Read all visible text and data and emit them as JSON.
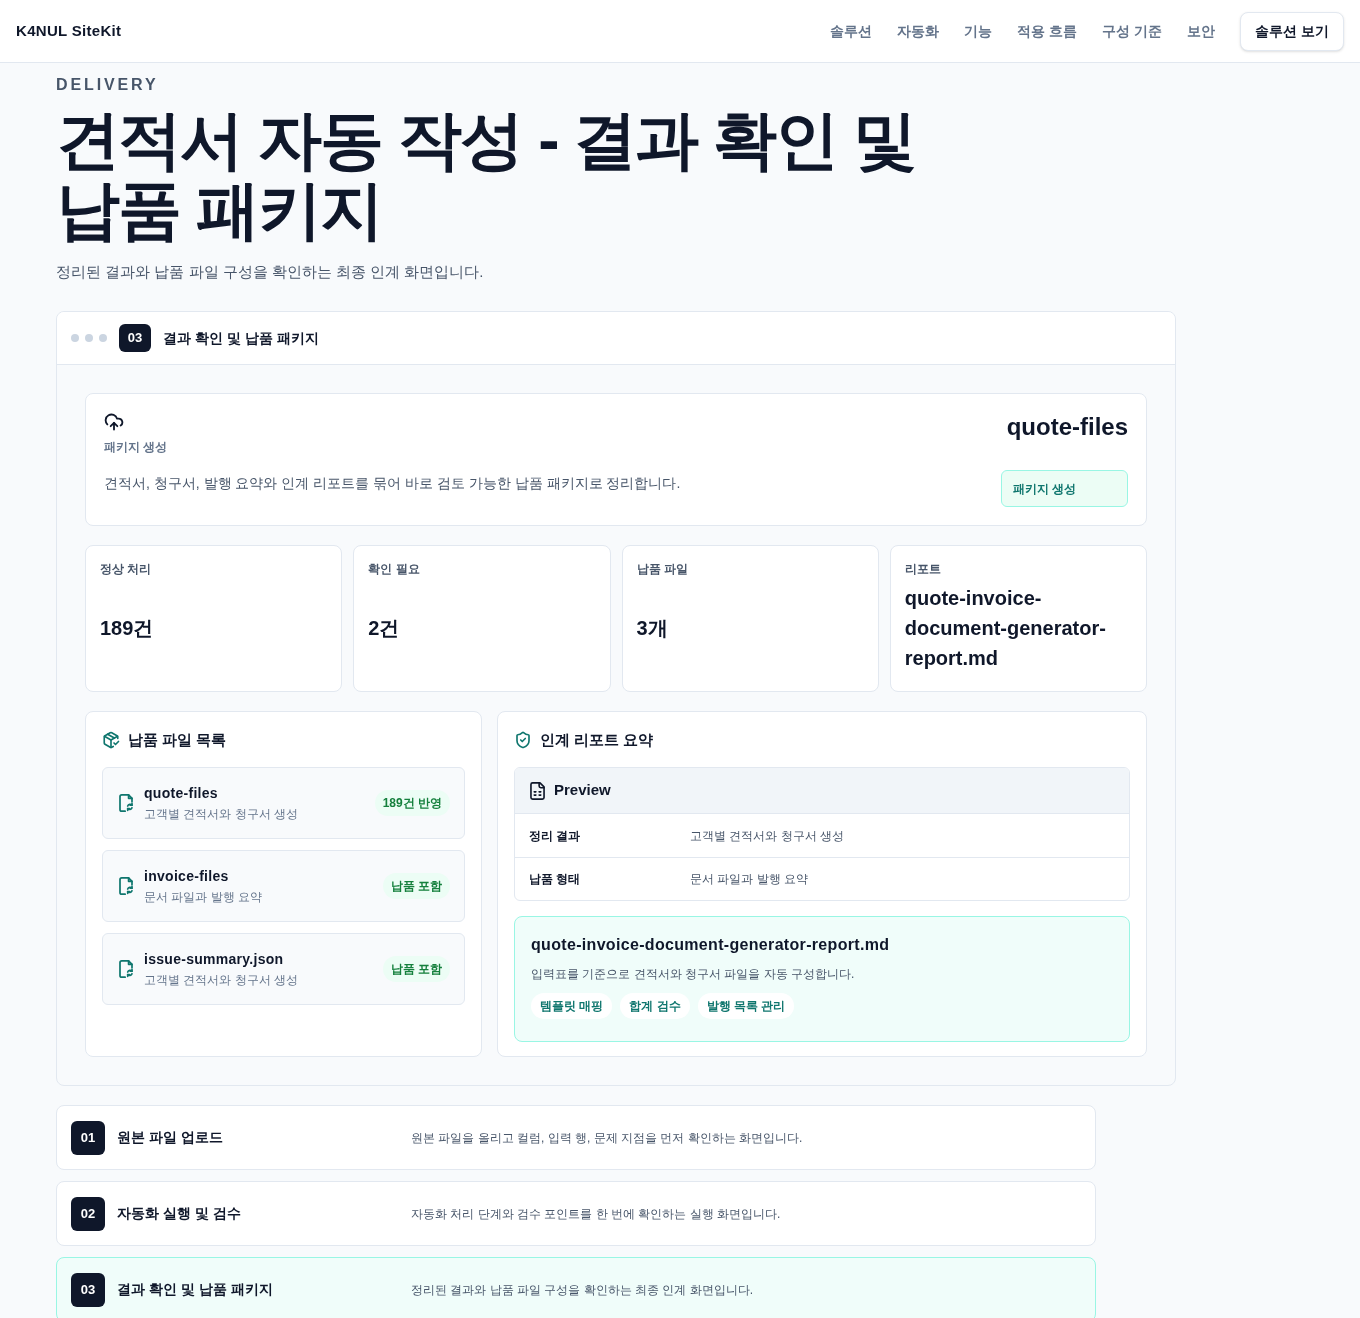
{
  "header": {
    "logo": "K4NUL SiteKit",
    "nav": [
      "솔루션",
      "자동화",
      "기능",
      "적용 흐름",
      "구성 기준",
      "보안"
    ],
    "cta": "솔루션 보기"
  },
  "hero": {
    "eyebrow": "DELIVERY",
    "title": "견적서 자동 작성 - 결과 확인 및 납품 패키지",
    "subtitle": "정리된 결과와 납품 파일 구성을 확인하는 최종 인계 화면입니다."
  },
  "panel": {
    "step": "03",
    "title": "결과 확인 및 납품 패키지",
    "package": {
      "label": "패키지 생성",
      "description": "견적서, 청구서, 발행 요약와 인계 리포트를 묶어 바로 검토 가능한 납품 패키지로 정리합니다.",
      "name": "quote-files",
      "button": "패키지 생성"
    },
    "stats": [
      {
        "label": "정상 처리",
        "value": "189건"
      },
      {
        "label": "확인 필요",
        "value": "2건"
      },
      {
        "label": "납품 파일",
        "value": "3개"
      },
      {
        "label": "리포트",
        "value": "quote-invoice-document-generator-report.md"
      }
    ],
    "file_list": {
      "title": "납품 파일 목록",
      "files": [
        {
          "name": "quote-files",
          "description": "고객별 견적서와 청구서 생성",
          "badge": "189건 반영"
        },
        {
          "name": "invoice-files",
          "description": "문서 파일과 발행 요약",
          "badge": "납품 포함"
        },
        {
          "name": "issue-summary.json",
          "description": "고객별 견적서와 청구서 생성",
          "badge": "납품 포함"
        }
      ]
    },
    "report_summary": {
      "title": "인계 리포트 요약",
      "preview": {
        "title": "Preview",
        "rows": [
          {
            "key": "정리 결과",
            "value": "고객별 견적서와 청구서 생성"
          },
          {
            "key": "납품 형태",
            "value": "문서 파일과 발행 요약"
          }
        ]
      },
      "report": {
        "filename": "quote-invoice-document-generator-report.md",
        "description": "입력표를 기준으로 견적서와 청구서 파일을 자동 구성합니다.",
        "tags": [
          "템플릿 매핑",
          "합계 검수",
          "발행 목록 관리"
        ]
      }
    }
  },
  "steps": [
    {
      "number": "01",
      "title": "원본 파일 업로드",
      "description": "원본 파일을 올리고 컬럼, 입력 행, 문제 지점을 먼저 확인하는 화면입니다.",
      "selected": false
    },
    {
      "number": "02",
      "title": "자동화 실행 및 검수",
      "description": "자동화 처리 단계와 검수 포인트를 한 번에 확인하는 실행 화면입니다.",
      "selected": false
    },
    {
      "number": "03",
      "title": "결과 확인 및 납품 패키지",
      "description": "정리된 결과와 납품 파일 구성을 확인하는 최종 인계 화면입니다.",
      "selected": true
    }
  ]
}
